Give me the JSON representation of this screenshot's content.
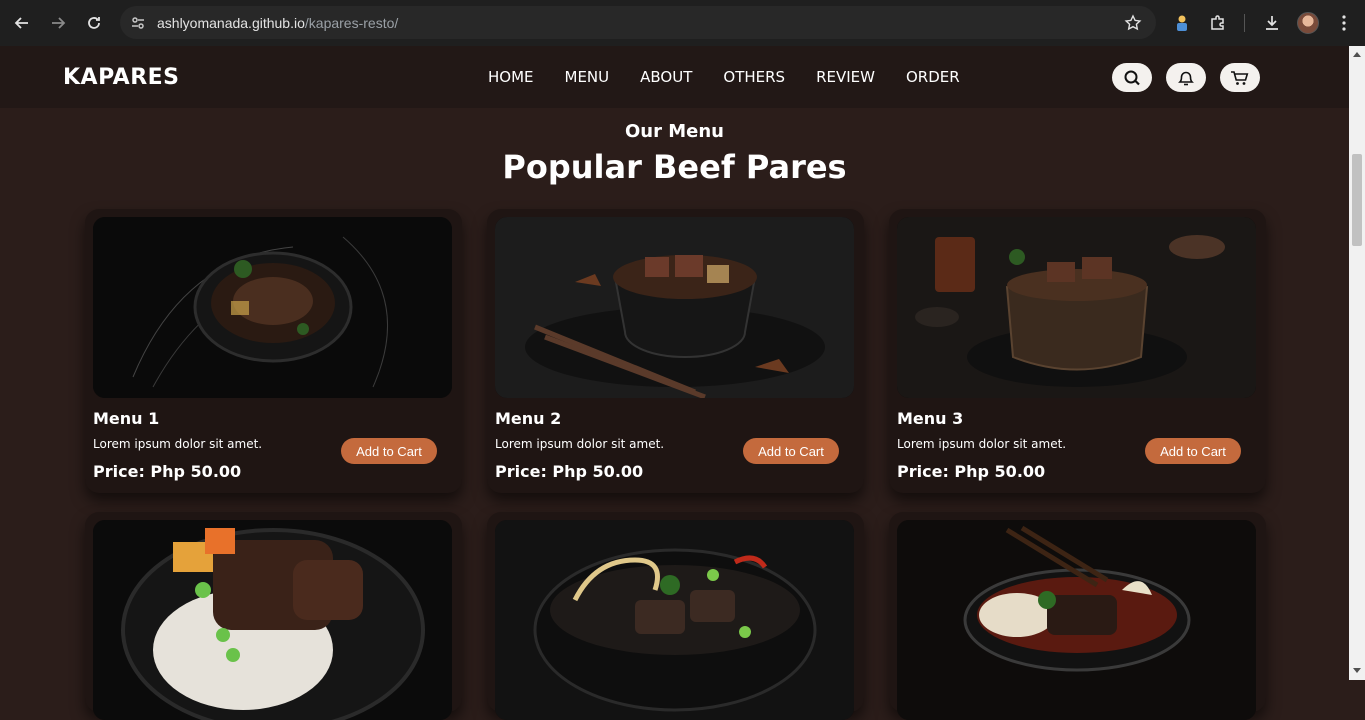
{
  "browser": {
    "url_host": "ashlyomanada.github.io",
    "url_path": "/kapares-resto/"
  },
  "site": {
    "logo": "KAPARES",
    "nav": [
      "HOME",
      "MENU",
      "ABOUT",
      "OTHERS",
      "REVIEW",
      "ORDER"
    ],
    "icons": [
      "search-icon",
      "bell-icon",
      "cart-icon"
    ]
  },
  "section": {
    "subtitle": "Our Menu",
    "title": "Popular Beef Pares"
  },
  "cards": [
    {
      "name": "Menu 1",
      "desc": "Lorem ipsum dolor sit amet.",
      "price": "Price: Php 50.00",
      "button": "Add to Cart"
    },
    {
      "name": "Menu 2",
      "desc": "Lorem ipsum dolor sit amet.",
      "price": "Price: Php 50.00",
      "button": "Add to Cart"
    },
    {
      "name": "Menu 3",
      "desc": "Lorem ipsum dolor sit amet.",
      "price": "Price: Php 50.00",
      "button": "Add to Cart"
    },
    {
      "name": "",
      "desc": "",
      "price": "",
      "button": ""
    },
    {
      "name": "",
      "desc": "",
      "price": "",
      "button": ""
    },
    {
      "name": "",
      "desc": "",
      "price": "",
      "button": ""
    }
  ],
  "colors": {
    "accent": "#c46a3d",
    "background": "#2b1d1a",
    "header": "#221816"
  }
}
